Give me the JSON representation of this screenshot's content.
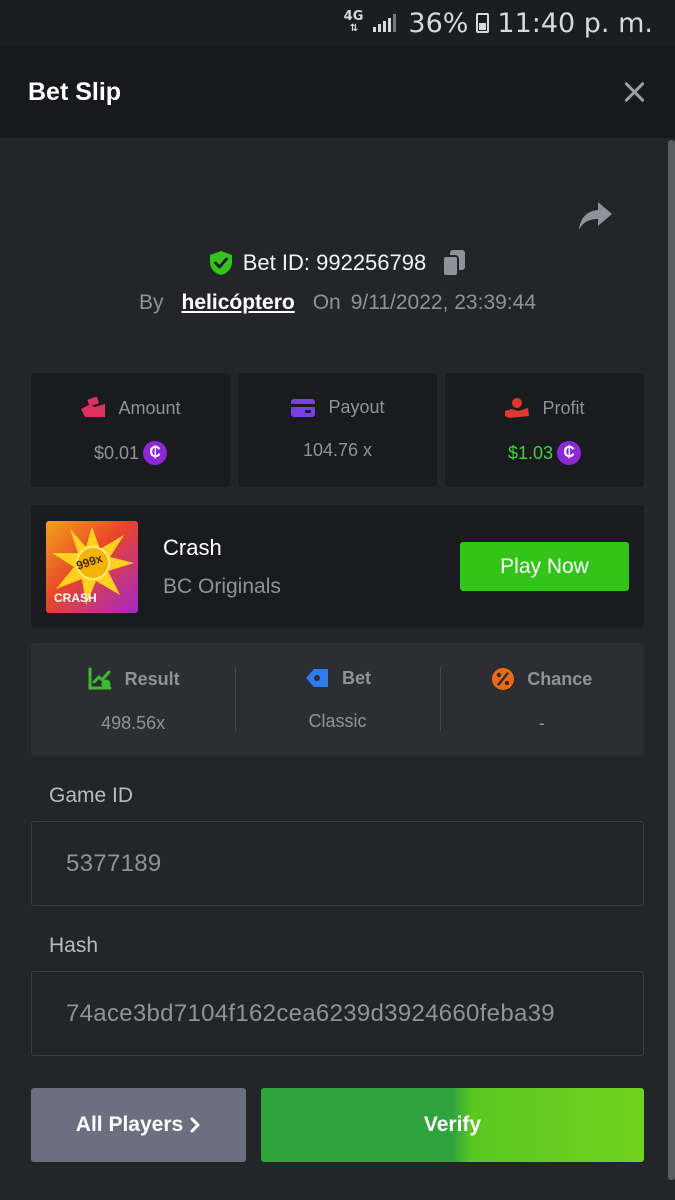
{
  "status_bar": {
    "network": "4G",
    "battery": "36%",
    "time": "11:40 p. m."
  },
  "header": {
    "title": "Bet Slip"
  },
  "bet": {
    "id_label": "Bet ID: 992256798",
    "by_label": "By",
    "user": "helicóptero",
    "on_label": "On",
    "datetime": "9/11/2022, 23:39:44"
  },
  "stats": [
    {
      "label": "Amount",
      "value": "$0.01",
      "coin": "₵"
    },
    {
      "label": "Payout",
      "value": "104.76 x"
    },
    {
      "label": "Profit",
      "value": "$1.03",
      "coin": "₵"
    }
  ],
  "game": {
    "thumb_badge": "999x",
    "thumb_label": "CRASH",
    "name": "Crash",
    "provider": "BC Originals",
    "play_label": "Play Now"
  },
  "info": [
    {
      "label": "Result",
      "value": "498.56x"
    },
    {
      "label": "Bet",
      "value": "Classic"
    },
    {
      "label": "Chance",
      "value": "-"
    }
  ],
  "fields": {
    "game_id_label": "Game ID",
    "game_id_value": "5377189",
    "hash_label": "Hash",
    "hash_value": "74ace3bd7104f162cea6239d3924660feba39"
  },
  "actions": {
    "all_players_label": "All Players",
    "verify_label": "Verify"
  },
  "colors": {
    "green": "#3ed33c",
    "coin_purple": "#8d28d6",
    "amount_pink": "#e0315e",
    "payout_purple": "#7a3fe4",
    "profit_red": "#e0392c",
    "result_green": "#3dbb2d",
    "bet_blue": "#2f7bf0",
    "chance_orange": "#ee6a12"
  }
}
